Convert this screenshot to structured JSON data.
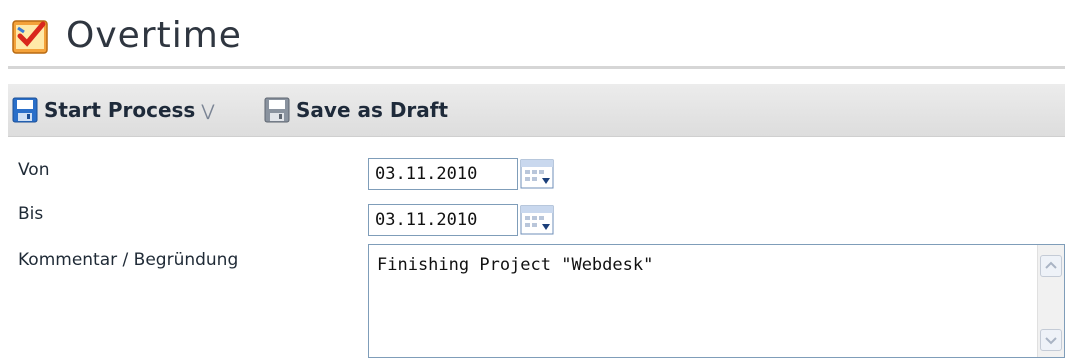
{
  "window": {
    "title": "Overtime",
    "app_icon": "overtime-form-icon"
  },
  "toolbar": {
    "start_process_label": "Start Process",
    "start_process_icon": "save-disk-icon",
    "dropdown_icon": "double-chevron-down-icon",
    "save_draft_label": "Save as Draft",
    "save_draft_icon": "save-disk-gray-icon"
  },
  "form": {
    "from_label": "Von",
    "from_value": "03.11.2010",
    "to_label": "Bis",
    "to_value": "03.11.2010",
    "calendar_icon": "calendar-icon",
    "comment_label": "Kommentar / Begründung",
    "comment_value": "Finishing Project \"Webdesk\""
  },
  "colors": {
    "toolbar_bg": "#e4e4e4",
    "input_border": "#7f9db9",
    "title_text": "#2f3640"
  }
}
